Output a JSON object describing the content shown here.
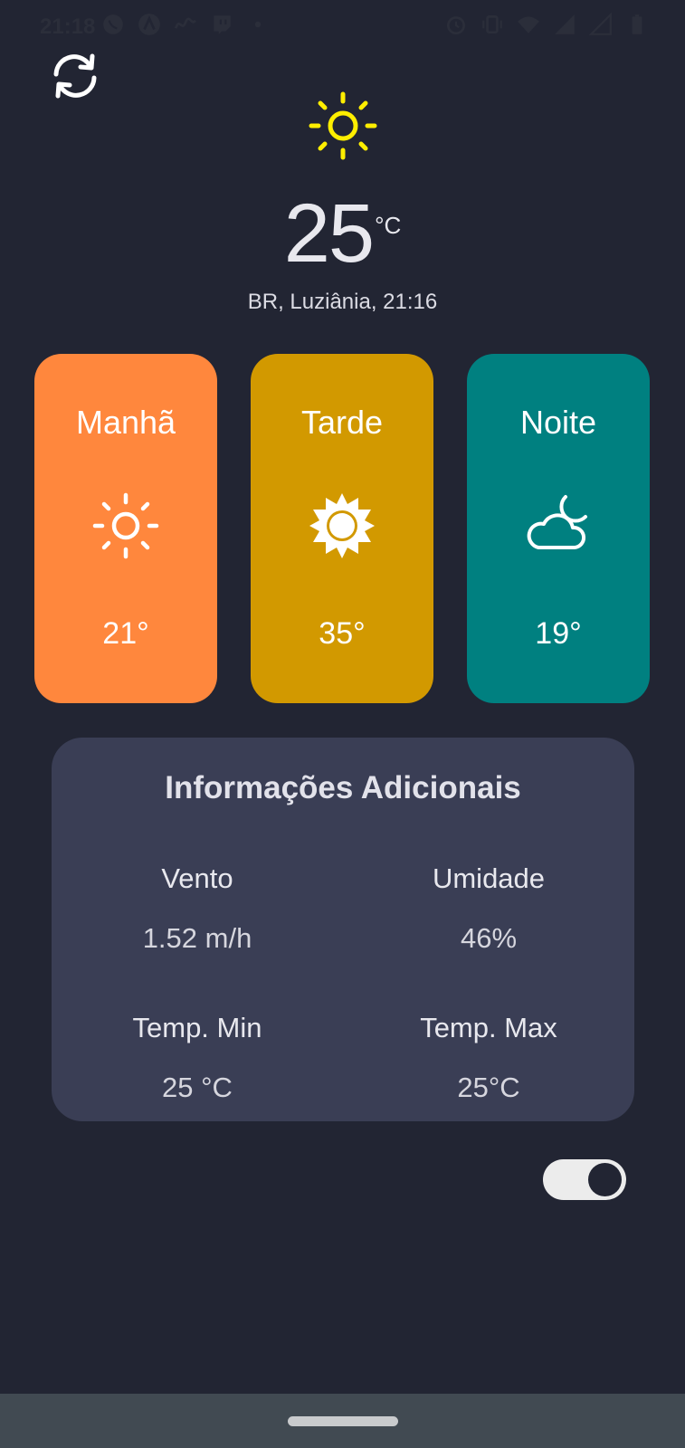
{
  "status_bar": {
    "time": "21:18",
    "left_icons": [
      "whatsapp-icon",
      "app-icon",
      "signature-icon",
      "twitch-icon",
      "dot-icon"
    ],
    "right_icons": [
      "alarm-icon",
      "vibrate-icon",
      "wifi-icon",
      "signal-4g-icon",
      "signal-icon",
      "battery-icon"
    ]
  },
  "refresh": {
    "icon": "refresh-icon"
  },
  "current": {
    "icon": "sun-icon",
    "temperature": "25",
    "unit": "°C",
    "location": "BR,  Luziânia, 21:16"
  },
  "periods": [
    {
      "label": "Manhã",
      "temp": "21°",
      "icon": "sun-outline-icon",
      "color": "#ff873d"
    },
    {
      "label": "Tarde",
      "temp": "35°",
      "icon": "sun-filled-icon",
      "color": "#d29900"
    },
    {
      "label": "Noite",
      "temp": "19°",
      "icon": "cloud-moon-icon",
      "color": "#008080"
    }
  ],
  "info": {
    "title": "Informações Adicionais",
    "wind_label": "Vento",
    "wind_value": "1.52 m/h",
    "humidity_label": "Umidade",
    "humidity_value": "46%",
    "min_label": "Temp. Min",
    "min_value": "25 °C",
    "max_label": "Temp. Max",
    "max_value": "25°C"
  },
  "theme_toggle": {
    "on": true
  },
  "colors": {
    "background": "#222533",
    "card": "#3a3e55",
    "sun": "#ffee00"
  }
}
